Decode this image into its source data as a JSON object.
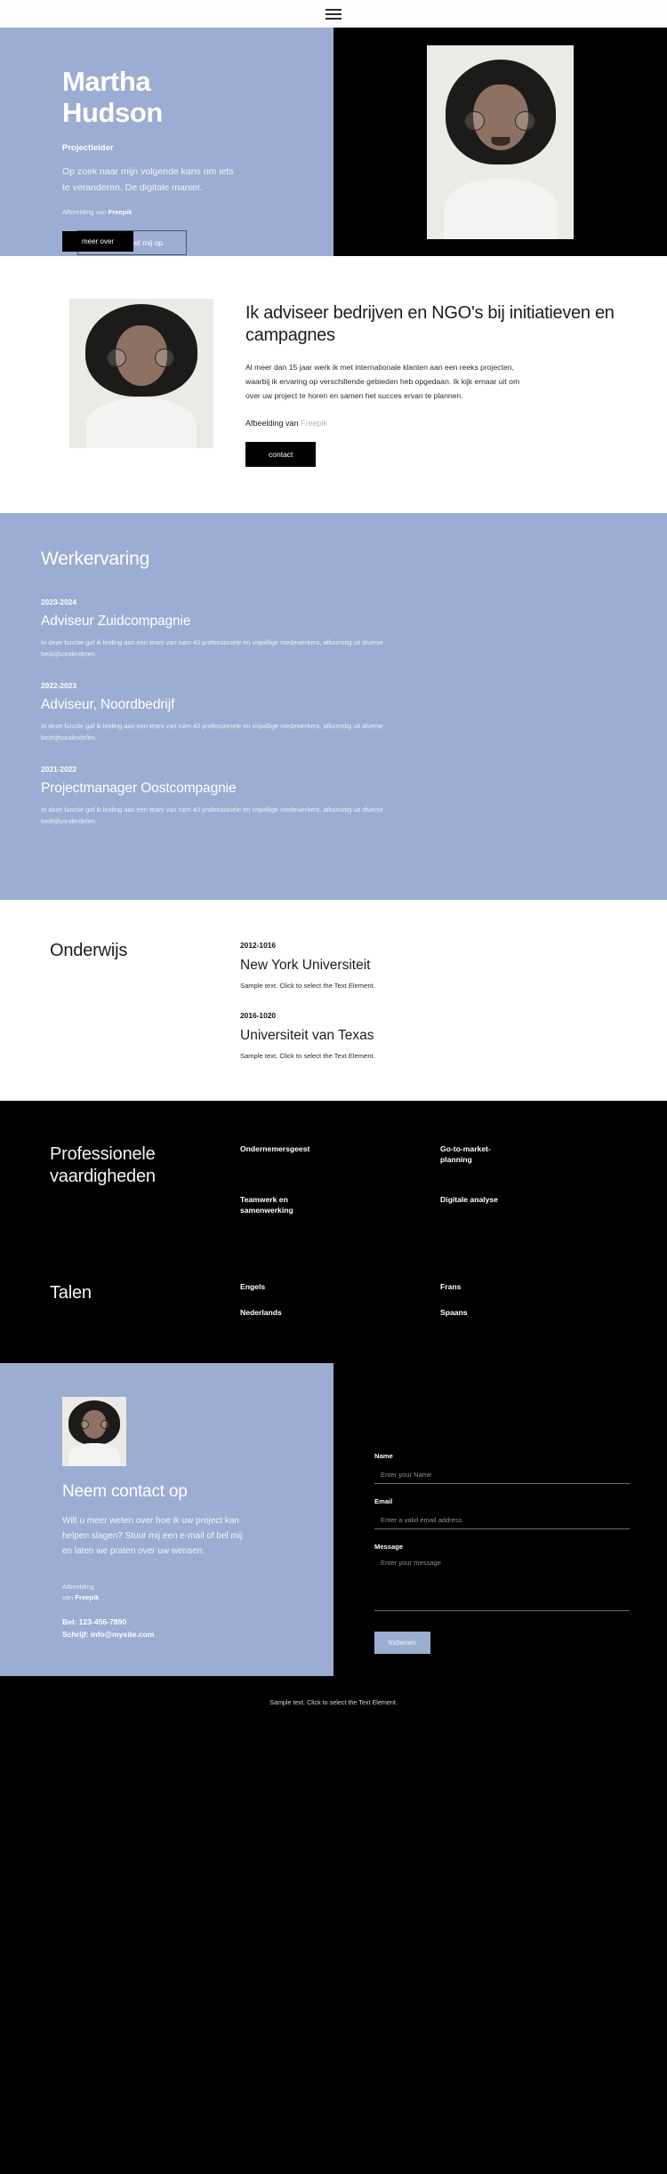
{
  "topbar": {
    "menu_icon": "hamburger-icon"
  },
  "hero": {
    "name": "Martha Hudson",
    "name_line1": "Martha",
    "name_line2": "Hudson",
    "role": "Projectleider",
    "description": "Op zoek naar mijn volgende kans om iets te veranderen. De digitale manier.",
    "credit_prefix": "Afbeelding van ",
    "credit_source": "Freepik",
    "btn_primary": "meer over",
    "btn_secondary": "contact met mij op",
    "accent_color": "#9badd2"
  },
  "about": {
    "title": "Ik adviseer bedrijven en NGO's bij initiatieven en campagnes",
    "body": "Al meer dan 15 jaar werk ik met internationale klanten aan een reeks projecten, waarbij ik ervaring op verschillende gebieden heb opgedaan. Ik kijk ernaar uit om over uw project te horen en samen het succes ervan te plannen.",
    "credit_prefix": "Afbeelding van ",
    "credit_source": "Freepik",
    "button": "contact"
  },
  "experience": {
    "title": "Werkervaring",
    "items": [
      {
        "date": "2023-2024",
        "role": "Adviseur Zuidcompagnie",
        "desc": "In deze functie gaf ik leiding aan een team van ruim 40 professionele en vrijwillige medewerkers, afkomstig uit diverse bedrijfsonderdelen."
      },
      {
        "date": "2022-2023",
        "role": "Adviseur, Noordbedrijf",
        "desc": "In deze functie gaf ik leiding aan een team van ruim 40 professionele en vrijwillige medewerkers, afkomstig uit diverse bedrijfsonderdelen."
      },
      {
        "date": "2021-2022",
        "role": "Projectmanager Oostcompagnie",
        "desc": "In deze functie gaf ik leiding aan een team van ruim 40 professionele en vrijwillige medewerkers, afkomstig uit diverse bedrijfsonderdelen."
      }
    ]
  },
  "education": {
    "title": "Onderwijs",
    "items": [
      {
        "date": "2012-1016",
        "school": "New York Universiteit",
        "desc": "Sample text. Click to select the Text Element."
      },
      {
        "date": "2016-1020",
        "school": "Universiteit van Texas",
        "desc": "Sample text. Click to select the Text Element."
      }
    ]
  },
  "skills": {
    "title_line1": "Professionele",
    "title_line2": "vaardigheden",
    "items": [
      "Ondernemersgeest",
      "Go-to-market-planning",
      "Teamwerk en samenwerking",
      "Digitale analyse"
    ]
  },
  "languages": {
    "title": "Talen",
    "items": [
      "Engels",
      "Frans",
      "Nederlands",
      "Spaans"
    ]
  },
  "contact": {
    "title": "Neem contact op",
    "body": "Wilt u meer weten over hoe ik uw project kan helpen slagen? Stuur mij een e-mail of bel mij en laten we praten over uw wensen.",
    "credit_line1": "Afbeelding",
    "credit_line2_prefix": "van ",
    "credit_source": "Freepik",
    "phone": "Bel: 123-456-7890",
    "email": "Schrijf: info@mysite.com",
    "form": {
      "name_label": "Name",
      "name_placeholder": "Enter your Name",
      "name_value": "",
      "email_label": "Email",
      "email_placeholder": "Enter a valid email address",
      "email_value": "",
      "message_label": "Message",
      "message_placeholder": "Enter your message",
      "message_value": "",
      "submit_label": "Indienen"
    }
  },
  "footer": {
    "text": "Sample text. Click to select the Text Element."
  }
}
